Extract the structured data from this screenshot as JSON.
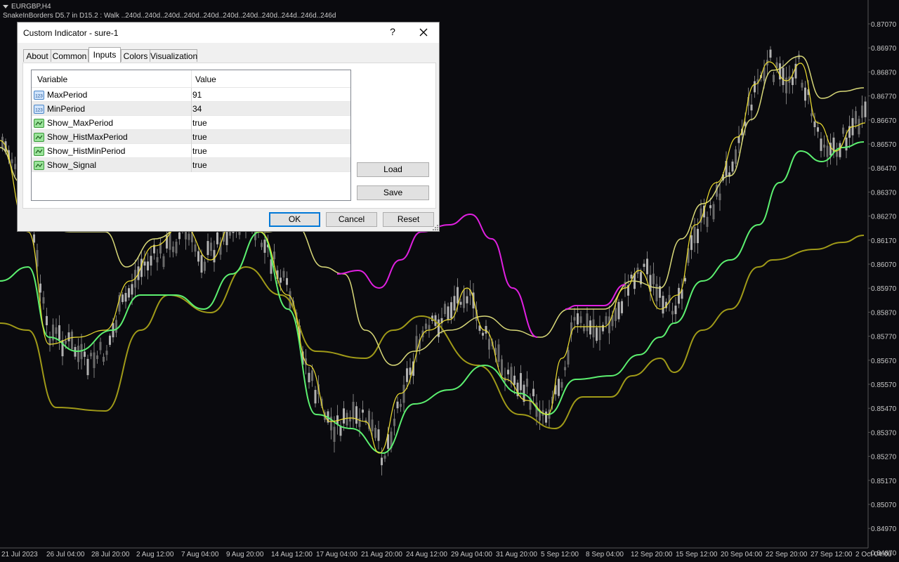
{
  "chart": {
    "symbol_line": "EURGBP,H4",
    "indicator_line": "SnakeInBorders D5.7 in D15.2 :    Walk ..240d..240d..240d..240d..240d..240d..240d..240d..244d..246d..246d",
    "price_labels": [
      "0.87070",
      "0.86970",
      "0.86870",
      "0.86770",
      "0.86670",
      "0.86570",
      "0.86470",
      "0.86370",
      "0.86270",
      "0.86170",
      "0.86070",
      "0.85970",
      "0.85870",
      "0.85770",
      "0.85670",
      "0.85570",
      "0.85470",
      "0.85370",
      "0.85270",
      "0.85170",
      "0.85070",
      "0.84970",
      "0.84870"
    ],
    "time_labels": [
      "21 Jul 2023",
      "26 Jul 04:00",
      "28 Jul 20:00",
      "2 Aug 12:00",
      "7 Aug 04:00",
      "9 Aug 20:00",
      "14 Aug 12:00",
      "17 Aug 04:00",
      "21 Aug 20:00",
      "24 Aug 12:00",
      "29 Aug 04:00",
      "31 Aug 20:00",
      "5 Sep 12:00",
      "8 Sep 04:00",
      "12 Sep 20:00",
      "15 Sep 12:00",
      "20 Sep 04:00",
      "22 Sep 20:00",
      "27 Sep 12:00",
      "2 Oct 04:00"
    ],
    "colors": {
      "background": "#0a0a0e",
      "candles": "#9a9a9a",
      "upper_band": "#d8d878",
      "signal": "#f0e030",
      "mid_line": "#5cf070",
      "lower_band": "#a09a18",
      "magenta": "#e020e0",
      "axis_text": "#c8c8c8"
    }
  },
  "dialog": {
    "title": "Custom Indicator - sure-1",
    "help_label": "?",
    "tabs": [
      "About",
      "Common",
      "Inputs",
      "Colors",
      "Visualization"
    ],
    "active_tab": "Inputs",
    "columns": [
      "Variable",
      "Value"
    ],
    "rows": [
      {
        "variable": "MaxPeriod",
        "value": "91",
        "icon": "integer-icon"
      },
      {
        "variable": "MinPeriod",
        "value": "34",
        "icon": "integer-icon"
      },
      {
        "variable": "Show_MaxPeriod",
        "value": "true",
        "icon": "boolean-icon"
      },
      {
        "variable": "Show_HistMaxPeriod",
        "value": "true",
        "icon": "boolean-icon"
      },
      {
        "variable": "Show_HistMinPeriod",
        "value": "true",
        "icon": "boolean-icon"
      },
      {
        "variable": "Show_Signal",
        "value": "true",
        "icon": "boolean-icon"
      }
    ],
    "load_label": "Load",
    "save_label": "Save",
    "ok_label": "OK",
    "cancel_label": "Cancel",
    "reset_label": "Reset"
  }
}
